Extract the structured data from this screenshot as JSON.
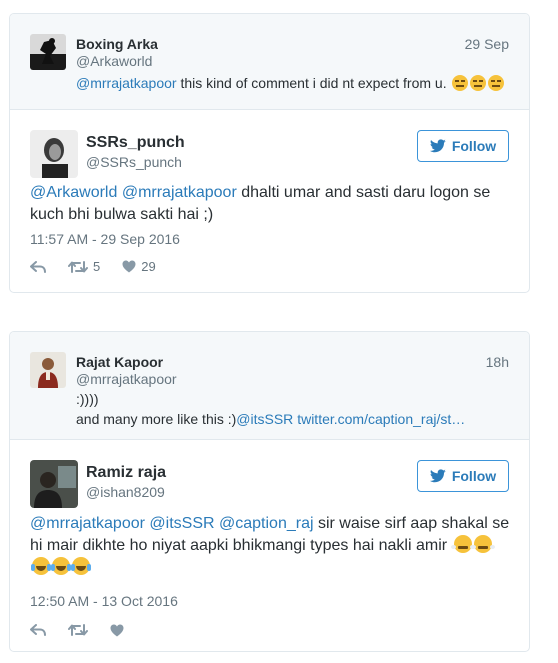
{
  "threads": [
    {
      "quoted": {
        "name": "Boxing Arka",
        "handle": "@Arkaworld",
        "time": "29 Sep",
        "mention": "@mrrajatkapoor",
        "text": " this kind of comment i did nt expect from u.",
        "emojis": [
          "expressionless-emoji",
          "expressionless-emoji",
          "expressionless-emoji"
        ]
      },
      "reply": {
        "name": "SSRs_punch",
        "handle": "@SSRs_punch",
        "follow_label": "Follow",
        "mention1": "@Arkaworld",
        "mention2": "@mrrajatkapoor",
        "text": " dhalti umar and sasti daru logon se kuch bhi bulwa sakti hai ;)",
        "timestamp": "11:57 AM - 29 Sep 2016",
        "retweets": "5",
        "likes": "29"
      }
    },
    {
      "quoted": {
        "name": "Rajat Kapoor",
        "handle": "@mrrajatkapoor",
        "time": "18h",
        "line1": ":))))",
        "line2_text": "and many more like this :)",
        "line2_mention": "@itsSSR",
        "line2_link": "twitter.com/caption_raj/st…"
      },
      "reply": {
        "name": "Ramiz raja",
        "handle": "@ishan8209",
        "follow_label": "Follow",
        "mention1": "@mrrajatkapoor",
        "mention2": "@itsSSR",
        "mention3": "@caption_raj",
        "text": " sir waise sirf aap shakal se hi mair dikhte ho niyat aapki bhikmangi types hai nakli amir",
        "emojis": [
          "triumph-emoji",
          "triumph-emoji",
          "joy-emoji",
          "joy-emoji",
          "joy-emoji"
        ],
        "timestamp": "12:50 AM - 13 Oct 2016"
      }
    }
  ],
  "colors": {
    "link": "#2b7bb9",
    "muted": "#66757f",
    "border": "#e1e8ed",
    "quoted_bg": "#f5f8fa"
  }
}
